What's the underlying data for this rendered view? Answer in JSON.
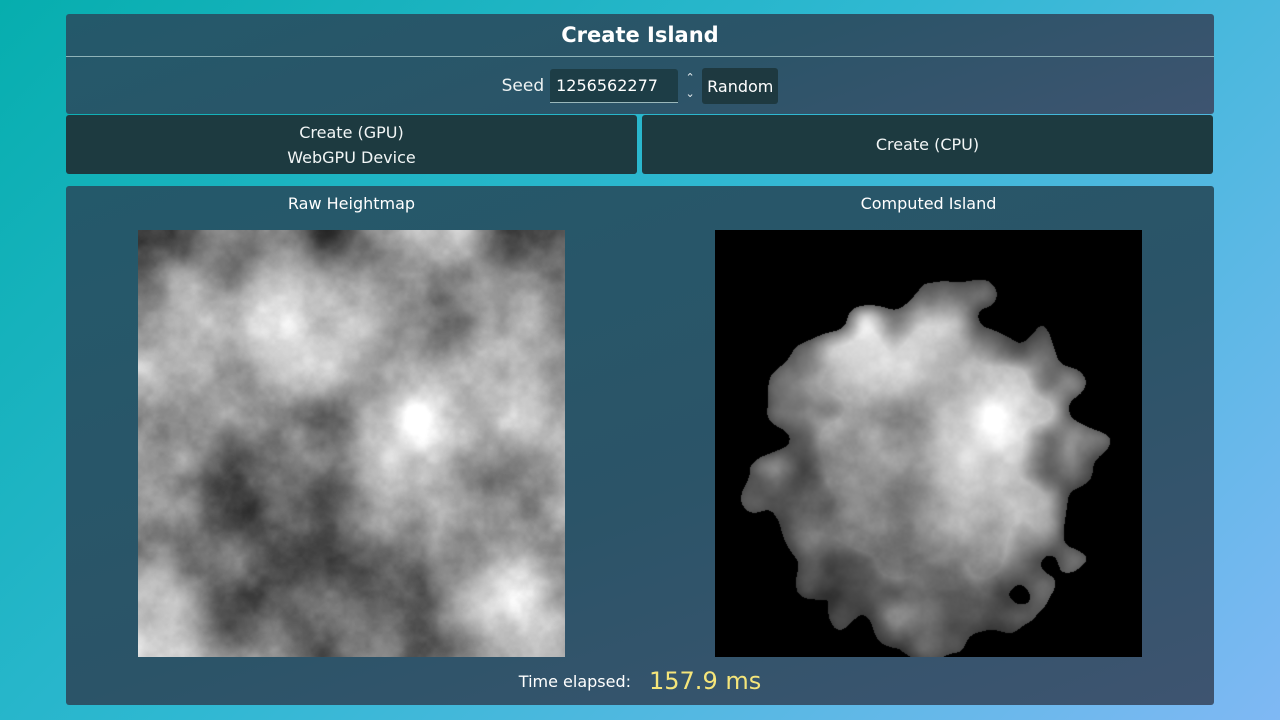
{
  "header": {
    "title": "Create Island"
  },
  "seed": {
    "label": "Seed",
    "value": "1256562277",
    "spinner_up_icon": "chevron-up-icon",
    "spinner_down_icon": "chevron-down-icon",
    "random_label": "Random"
  },
  "actions": {
    "gpu_label": "Create (GPU)",
    "gpu_sublabel": "WebGPU Device",
    "cpu_label": "Create (CPU)"
  },
  "maps": {
    "raw_title": "Raw Heightmap",
    "island_title": "Computed Island"
  },
  "timing": {
    "label": "Time elapsed:",
    "value": "157.9 ms"
  },
  "colors": {
    "accent_time": "#f5e57a",
    "panel": "#2b5468",
    "button": "#1d3a40",
    "input": "#1d3d46"
  }
}
